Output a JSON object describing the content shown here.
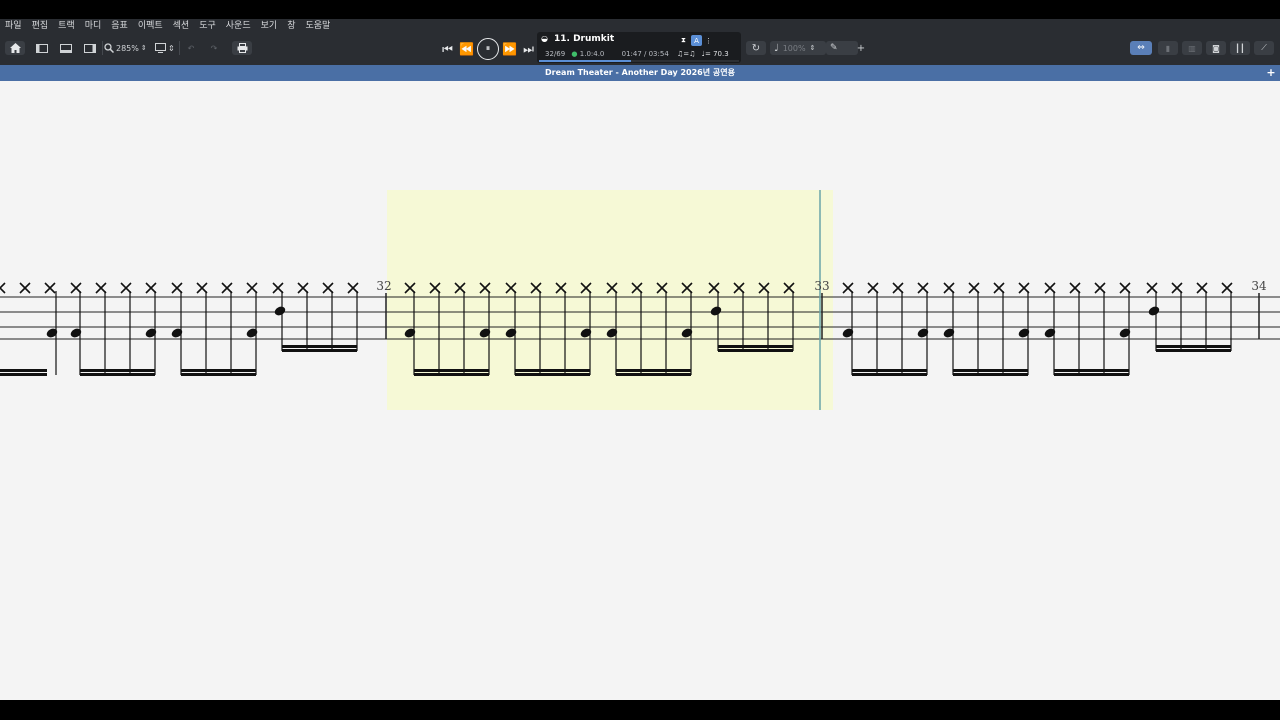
{
  "menu": [
    "파일",
    "편집",
    "트랙",
    "마디",
    "음표",
    "이펙트",
    "섹션",
    "도구",
    "사운드",
    "보기",
    "창",
    "도움말"
  ],
  "toolbar": {
    "zoom_value": "285%",
    "home_icon": "home-icon",
    "print_icon": "print-icon"
  },
  "transport": {
    "first": "⏮",
    "rewind": "⏪",
    "pause": "⏸",
    "forward": "⏩",
    "last": "⏭"
  },
  "lcd": {
    "track_name": "11. Drumkit",
    "bar_position": "32/69",
    "beat_position": "1.0:4.0",
    "time": "01:47 / 03:54",
    "triplet_feel": "♫=♫",
    "tempo": "♩= 70.3",
    "progress_percent": 46,
    "badge_a": "A"
  },
  "right_tools": {
    "speed_value": "100%",
    "loop_icon": "loop-icon"
  },
  "document": {
    "title": "Dream Theater - Another Day 2026년 공연용",
    "add_icon": "+"
  },
  "score": {
    "measure_numbers": [
      "32",
      "33",
      "34"
    ],
    "highlight_color": "#f6f9d6",
    "cursor_color": "#6aa6a8"
  }
}
